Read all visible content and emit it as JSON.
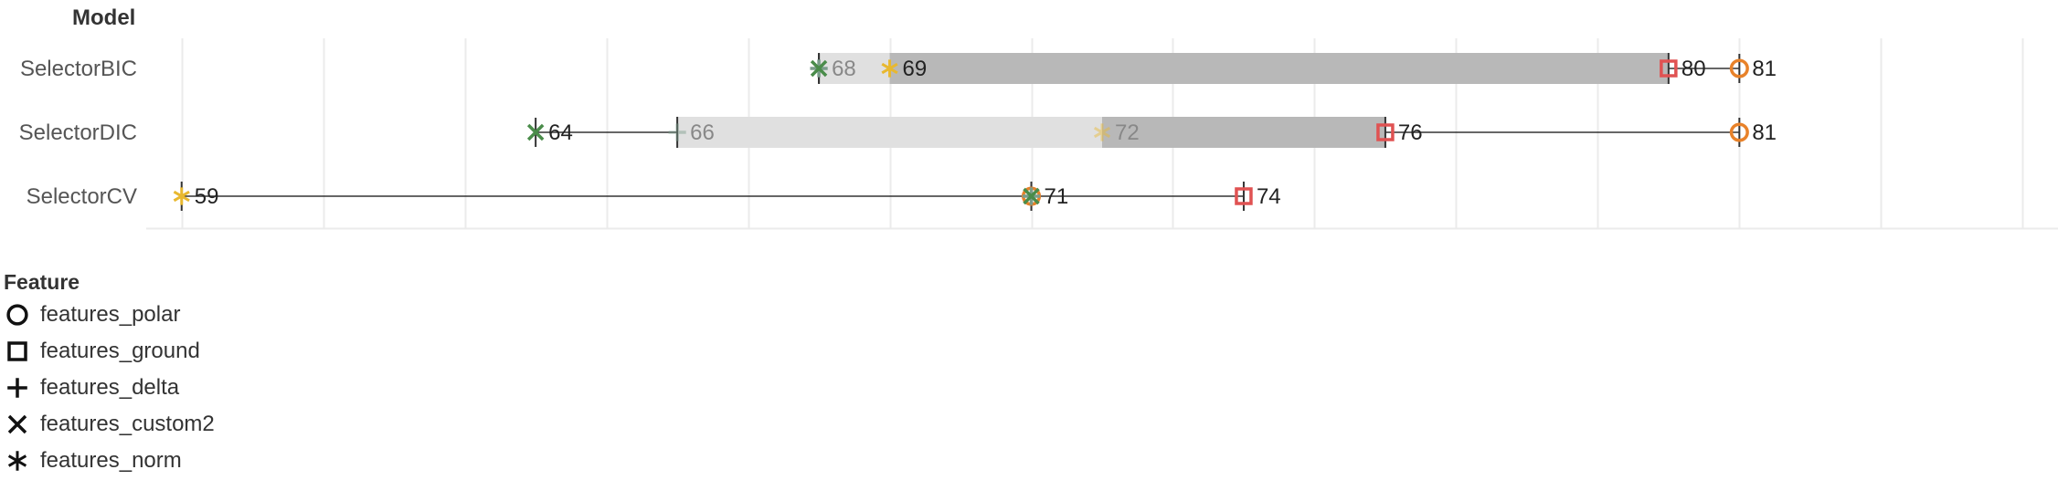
{
  "header": {
    "row_title": "Model"
  },
  "legend": {
    "title": "Feature",
    "items": [
      {
        "label": "features_polar",
        "shape": "circle"
      },
      {
        "label": "features_ground",
        "shape": "square"
      },
      {
        "label": "features_delta",
        "shape": "plus"
      },
      {
        "label": "features_custom2",
        "shape": "cross"
      },
      {
        "label": "features_norm",
        "shape": "asterisk"
      }
    ]
  },
  "colors": {
    "features_polar": "#e8822a",
    "features_ground": "#e05252",
    "features_delta": "#7a9c8a",
    "features_custom2": "#4a8c4a",
    "features_norm": "#e8b830",
    "band_light": "#e0e0e0",
    "band_dark": "#b8b8b8",
    "range_line": "#333333",
    "gridline": "#ebebeb"
  },
  "chart_data": {
    "type": "scatter",
    "title": "",
    "xlabel": "",
    "ylabel": "Model",
    "xlim": [
      58.5,
      85.5
    ],
    "grid": true,
    "categories": [
      "SelectorBIC",
      "SelectorDIC",
      "SelectorCV"
    ],
    "series": [
      {
        "name": "features_polar",
        "values": [
          81,
          81,
          71
        ]
      },
      {
        "name": "features_ground",
        "values": [
          80,
          76,
          74
        ]
      },
      {
        "name": "features_delta",
        "values": [
          68,
          66,
          71
        ]
      },
      {
        "name": "features_custom2",
        "values": [
          68,
          64,
          71
        ]
      },
      {
        "name": "features_norm",
        "values": [
          69,
          72,
          59
        ]
      }
    ],
    "labels": [
      [
        {
          "text": "68",
          "x": 68,
          "muted": true
        },
        {
          "text": "69",
          "x": 69,
          "muted": false
        },
        {
          "text": "80",
          "x": 80,
          "muted": false
        },
        {
          "text": "81",
          "x": 81,
          "muted": false
        }
      ],
      [
        {
          "text": "64",
          "x": 64,
          "muted": false
        },
        {
          "text": "66",
          "x": 66,
          "muted": true
        },
        {
          "text": "72",
          "x": 72,
          "muted": true
        },
        {
          "text": "76",
          "x": 76,
          "muted": false
        },
        {
          "text": "81",
          "x": 81,
          "muted": false
        }
      ],
      [
        {
          "text": "59",
          "x": 59,
          "muted": false
        },
        {
          "text": "71",
          "x": 71,
          "muted": false
        },
        {
          "text": "74",
          "x": 74,
          "muted": false
        }
      ]
    ]
  }
}
